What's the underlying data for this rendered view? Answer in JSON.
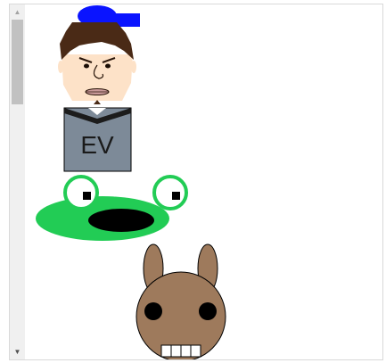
{
  "badge": {
    "text": "EV"
  },
  "colors": {
    "hat": "#0a14ff",
    "hair": "#4a2a16",
    "skin": "#fde2c8",
    "shirt": "#7d8a98",
    "frog": "#22cc55",
    "rabbit": "#9e7a5c"
  },
  "icons": {
    "scroll_up": "scroll-up-arrow",
    "scroll_down": "scroll-down-arrow"
  }
}
